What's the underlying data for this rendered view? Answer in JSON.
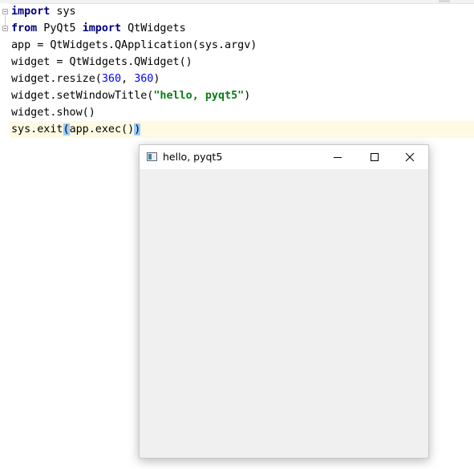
{
  "editor": {
    "lines": [
      "import sys",
      "from PyQt5 import QtWidgets",
      "app = QtWidgets.QApplication(sys.argv)",
      "widget = QtWidgets.QWidget()",
      "widget.resize(360, 360)",
      "widget.setWindowTitle(\"hello, pyqt5\")",
      "widget.show()",
      "sys.exit(app.exec())"
    ],
    "tokens": {
      "import": "import",
      "from": "from",
      "sys": " sys",
      "pyqt5": " PyQt5 ",
      "qtwidgets": " QtWidgets",
      "resize_prefix": "widget.resize(",
      "num_360": "360",
      "comma": ", ",
      "close_paren": ")",
      "settitle_prefix": "widget.setWindowTitle(",
      "title_string": "\"hello, pyqt5\"",
      "exit_prefix": "sys.exit",
      "open_paren_hl": "(",
      "exec_call": "app.exec()",
      "close_paren_hl": ")"
    }
  },
  "window": {
    "title": "hello, pyqt5",
    "icon": "qt-window-icon",
    "controls": {
      "minimize": "minimize-icon",
      "maximize": "maximize-icon",
      "close": "close-icon"
    }
  },
  "colors": {
    "keyword": "#000080",
    "number": "#0000ff",
    "string": "#067d17",
    "caret_line": "#fffae3",
    "brace_match": "#99ccff",
    "window_bg": "#f0f0f0"
  }
}
